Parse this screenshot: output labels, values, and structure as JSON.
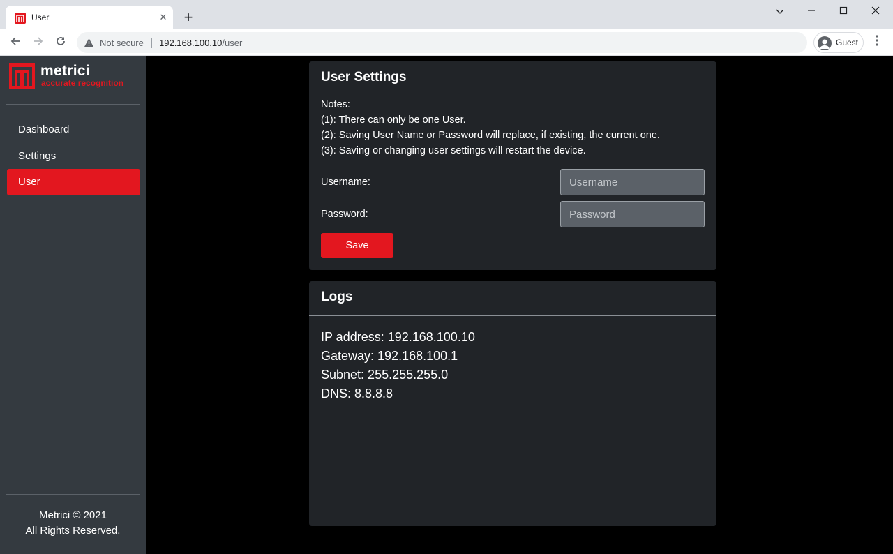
{
  "browser": {
    "tab_title": "User",
    "tab_close": "✕",
    "new_tab": "+",
    "security_label": "Not secure",
    "url_host": "192.168.100.10",
    "url_path": "/user",
    "profile_label": "Guest",
    "icons": [
      "app-favicon",
      "close-icon",
      "plus-icon",
      "chevron-down-icon",
      "minimize-icon",
      "maximize-icon",
      "close-window-icon",
      "back-icon",
      "forward-icon",
      "reload-icon",
      "warning-icon",
      "avatar-icon",
      "kebab-menu-icon"
    ]
  },
  "sidebar": {
    "logo": {
      "name": "metrici",
      "tagline": "accurate recognition",
      "accent": "#e3171f"
    },
    "items": [
      {
        "label": "Dashboard",
        "active": false
      },
      {
        "label": "Settings",
        "active": false
      },
      {
        "label": "User",
        "active": true
      }
    ],
    "footer_line1": "Metrici © 2021",
    "footer_line2": "All Rights Reserved."
  },
  "user_settings": {
    "title": "User Settings",
    "notes": [
      "Notes:",
      "(1): There can only be one User.",
      "(2): Saving User Name or Password will replace, if existing, the current one.",
      "(3): Saving or changing user settings will restart the device."
    ],
    "username_label": "Username:",
    "username_placeholder": "Username",
    "username_value": "",
    "password_label": "Password:",
    "password_placeholder": "Password",
    "password_value": "",
    "save_label": "Save"
  },
  "logs": {
    "title": "Logs",
    "lines": [
      "IP address: 192.168.100.10",
      "Gateway: 192.168.100.1",
      "Subnet: 255.255.255.0",
      "DNS: 8.8.8.8"
    ]
  },
  "colors": {
    "accent": "#e3171f",
    "sidebar_bg": "#343a40",
    "card_bg": "#212428",
    "page_bg": "#000000"
  }
}
